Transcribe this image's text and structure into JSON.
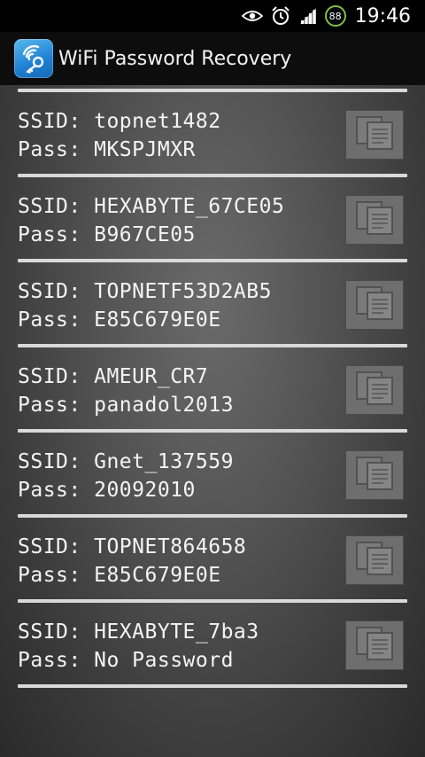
{
  "status_bar": {
    "battery_level": "88",
    "time": "19:46",
    "icons": [
      "eye-icon",
      "alarm-clock-icon",
      "signal-bars-icon",
      "battery-icon"
    ],
    "battery_color": "#7fc241"
  },
  "app_bar": {
    "title": "WiFi Password Recovery",
    "icon": "wifi-key-icon",
    "accent_color": "#1e7fd2"
  },
  "networks": [
    {
      "ssid_label": "SSID:",
      "ssid": "topnet1482",
      "pass_label": "Pass:",
      "pass": "MKSPJMXR"
    },
    {
      "ssid_label": "SSID:",
      "ssid": "HEXABYTE_67CE05",
      "pass_label": "Pass:",
      "pass": "B967CE05"
    },
    {
      "ssid_label": "SSID:",
      "ssid": "TOPNETF53D2AB5",
      "pass_label": "Pass:",
      "pass": "E85C679E0E"
    },
    {
      "ssid_label": "SSID:",
      "ssid": "AMEUR_CR7",
      "pass_label": "Pass:",
      "pass": "panadol2013"
    },
    {
      "ssid_label": "SSID:",
      "ssid": "Gnet_137559",
      "pass_label": "Pass:",
      "pass": "20092010"
    },
    {
      "ssid_label": "SSID:",
      "ssid": "TOPNET864658",
      "pass_label": "Pass:",
      "pass": "E85C679E0E"
    },
    {
      "ssid_label": "SSID:",
      "ssid": "HEXABYTE_7ba3",
      "pass_label": "Pass:",
      "pass": "No Password"
    }
  ],
  "copy_icon": "copy-icon"
}
